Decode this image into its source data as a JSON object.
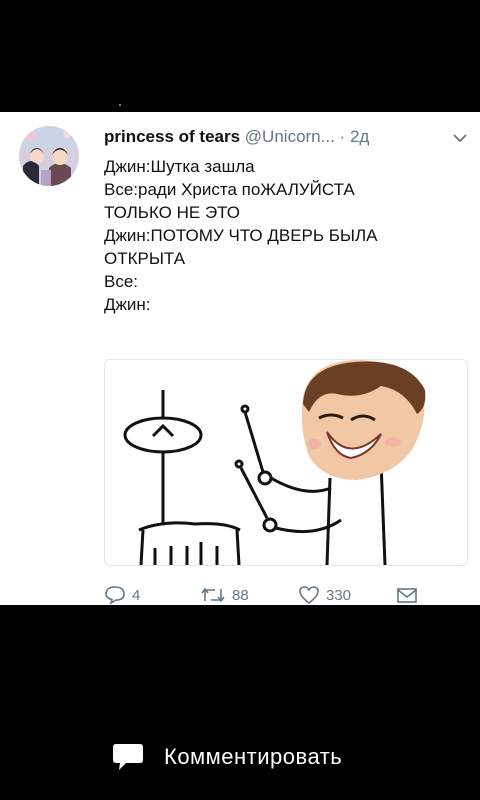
{
  "tweet": {
    "display_name": "princess of tears",
    "handle": "@Unicorn...",
    "separator": "·",
    "time": "2д",
    "lines": [
      "Джин:Шутка зашла",
      "Все:ради Христа поЖАЛУЙСТА",
      "ТОЛЬКО НЕ ЭТО",
      "Джин:ПОТОМУ ЧТО ДВЕРЬ БЫЛА",
      "ОТКРЫТА",
      "Все:",
      "Джин:"
    ],
    "counts": {
      "replies": "4",
      "retweets": "88",
      "likes": "330"
    }
  },
  "icons": {
    "reply": "reply-icon",
    "retweet": "retweet-icon",
    "like": "heart-icon",
    "dm": "envelope-icon",
    "caret": "chevron-down-icon",
    "comment": "speech-bubble-icon"
  },
  "bottom_bar": {
    "comment_label": "Комментировать"
  },
  "colors": {
    "background": "#000000",
    "card": "#ffffff",
    "muted": "#657786",
    "text": "#111111"
  }
}
